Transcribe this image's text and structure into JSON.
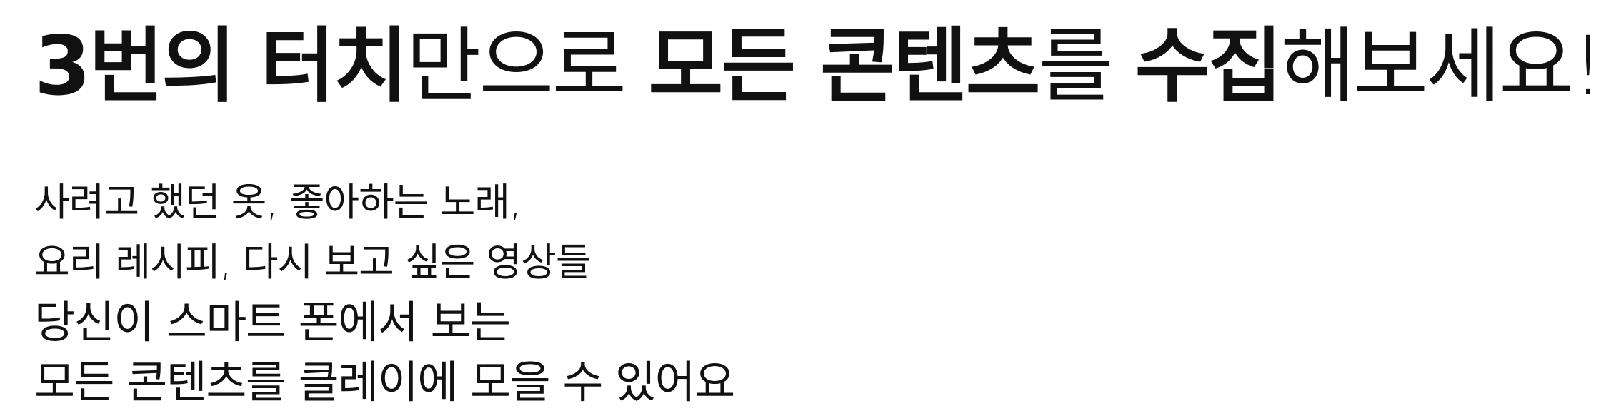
{
  "headline": {
    "segments": [
      {
        "text": "3번의 터치",
        "weight": "bold"
      },
      {
        "text": "만으로 ",
        "weight": "light"
      },
      {
        "text": "모든 콘텐츠",
        "weight": "bold"
      },
      {
        "text": "를 ",
        "weight": "light"
      },
      {
        "text": "수집",
        "weight": "bold"
      },
      {
        "text": "해보세요!",
        "weight": "light"
      }
    ]
  },
  "body": {
    "lines": [
      "사려고 했던 옷, 좋아하는 노래,",
      "요리 레시피, 다시 보고 싶은 영상들",
      "당신이 스마트 폰에서 보는",
      "모든 콘텐츠를 클레이에 모을 수 있어요"
    ]
  }
}
